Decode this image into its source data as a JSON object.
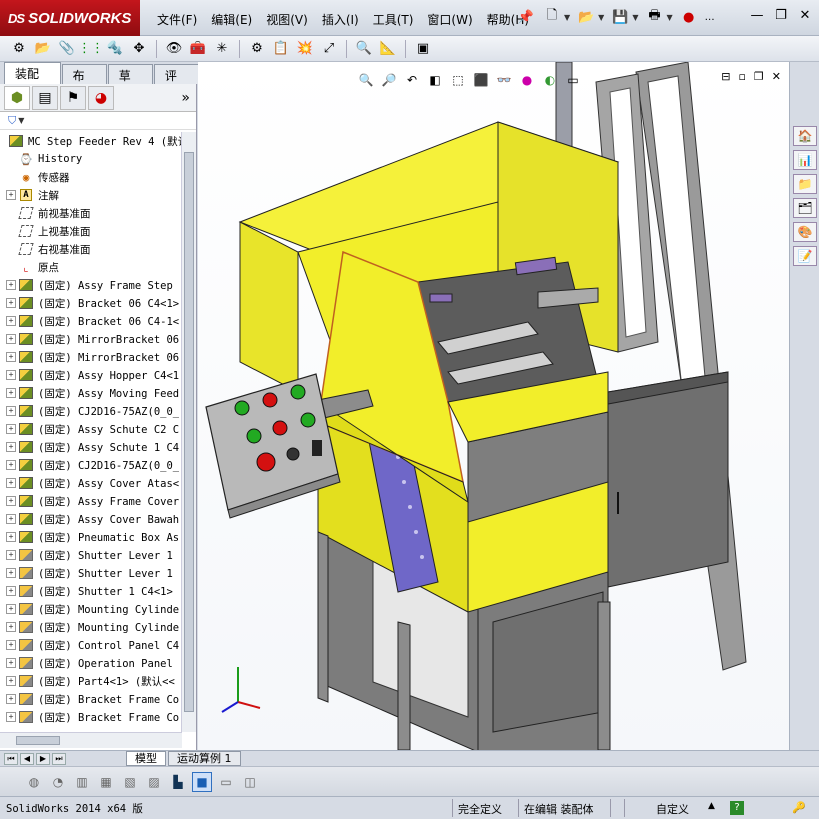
{
  "app": {
    "logo_text": "SOLIDWORKS",
    "logo_ds": "DS"
  },
  "menu": [
    "文件(F)",
    "编辑(E)",
    "视图(V)",
    "插入(I)",
    "工具(T)",
    "窗口(W)",
    "帮助(H)"
  ],
  "title_toolbar": {
    "icons": [
      "pushpin-icon",
      "new-document-icon",
      "open-folder-icon",
      "save-icon",
      "print-icon",
      "traffic-light-icon"
    ],
    "rebuild_label": "…"
  },
  "command_tabs": [
    {
      "label": "装配体",
      "active": true
    },
    {
      "label": "布局",
      "active": false
    },
    {
      "label": "草图",
      "active": false
    },
    {
      "label": "评估",
      "active": false
    }
  ],
  "feature_manager": {
    "more_glyph": "»",
    "filter_glyph": "▼",
    "root": "MC Step Feeder Rev 4  (默认",
    "items": [
      {
        "expander": "",
        "icon": "history-icon",
        "label": "History"
      },
      {
        "expander": "",
        "icon": "sensor-icon",
        "label": "传感器"
      },
      {
        "expander": "+",
        "icon": "annotation-icon",
        "label": "注解"
      },
      {
        "expander": "",
        "icon": "plane-icon",
        "label": "前视基准面"
      },
      {
        "expander": "",
        "icon": "plane-icon",
        "label": "上视基准面"
      },
      {
        "expander": "",
        "icon": "plane-icon",
        "label": "右视基准面"
      },
      {
        "expander": "",
        "icon": "origin-icon",
        "label": "原点"
      },
      {
        "expander": "+",
        "icon": "assembly-icon",
        "label": "(固定) Assy Frame Step"
      },
      {
        "expander": "+",
        "icon": "assembly-icon",
        "label": "(固定) Bracket 06 C4<1>"
      },
      {
        "expander": "+",
        "icon": "assembly-icon",
        "label": "(固定) Bracket 06 C4-1<"
      },
      {
        "expander": "+",
        "icon": "assembly-icon",
        "label": "(固定) MirrorBracket 06"
      },
      {
        "expander": "+",
        "icon": "assembly-icon",
        "label": "(固定) MirrorBracket 06"
      },
      {
        "expander": "+",
        "icon": "assembly-icon",
        "label": "(固定) Assy Hopper C4<1"
      },
      {
        "expander": "+",
        "icon": "assembly-icon",
        "label": "(固定) Assy Moving Feed"
      },
      {
        "expander": "+",
        "icon": "assembly-icon",
        "label": "(固定) CJ2D16-75AZ(0_0_"
      },
      {
        "expander": "+",
        "icon": "assembly-icon",
        "label": "(固定) Assy Schute C2 C"
      },
      {
        "expander": "+",
        "icon": "assembly-icon",
        "label": "(固定) Assy Schute 1 C4"
      },
      {
        "expander": "+",
        "icon": "assembly-icon",
        "label": "(固定) CJ2D16-75AZ(0_0_"
      },
      {
        "expander": "+",
        "icon": "assembly-icon",
        "label": "(固定) Assy Cover Atas<"
      },
      {
        "expander": "+",
        "icon": "assembly-icon",
        "label": "(固定) Assy Frame Cover"
      },
      {
        "expander": "+",
        "icon": "assembly-icon",
        "label": "(固定) Assy Cover Bawah"
      },
      {
        "expander": "+",
        "icon": "assembly-icon",
        "label": "(固定) Pneumatic Box As"
      },
      {
        "expander": "+",
        "icon": "part-icon",
        "label": "(固定) Shutter Lever 1"
      },
      {
        "expander": "+",
        "icon": "part-icon",
        "label": "(固定) Shutter Lever 1"
      },
      {
        "expander": "+",
        "icon": "part-icon",
        "label": "(固定) Shutter 1 C4<1>"
      },
      {
        "expander": "+",
        "icon": "part-icon",
        "label": "(固定) Mounting Cylinde"
      },
      {
        "expander": "+",
        "icon": "part-icon",
        "label": "(固定) Mounting Cylinde"
      },
      {
        "expander": "+",
        "icon": "part-icon",
        "label": "(固定) Control Panel C4"
      },
      {
        "expander": "+",
        "icon": "part-icon",
        "label": "(固定) Operation Panel"
      },
      {
        "expander": "+",
        "icon": "part-icon",
        "label": "(固定) Part4<1> (默认<<"
      },
      {
        "expander": "+",
        "icon": "part-icon",
        "label": "(固定) Bracket Frame Co"
      },
      {
        "expander": "+",
        "icon": "part-icon",
        "label": "(固定) Bracket Frame Co"
      }
    ]
  },
  "bottom_tabs": [
    {
      "label": "模型",
      "active": true
    },
    {
      "label": "运动算例 1",
      "active": false
    }
  ],
  "status": {
    "app": "SolidWorks 2014 x64 版",
    "definition": "完全定义",
    "editing": "在编辑 装配体",
    "units": "自定义"
  },
  "colors": {
    "cover_yellow": "#f2ee2a",
    "frame_gray": "#8c8c8c",
    "bracket_purple": "#6f67c8",
    "button_green": "#22aa22",
    "button_red": "#d41010"
  }
}
